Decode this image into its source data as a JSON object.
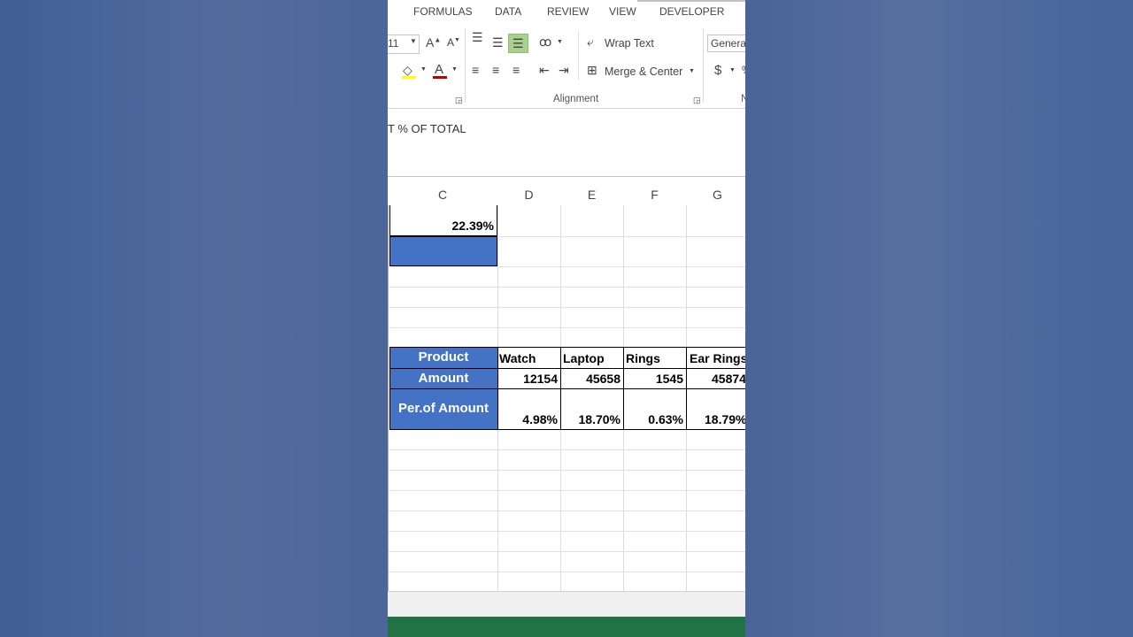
{
  "ribbon": {
    "tabs": [
      "FORMULAS",
      "DATA",
      "REVIEW",
      "VIEW",
      "DEVELOPER"
    ],
    "font_size": "11",
    "wrap_text": "Wrap Text",
    "merge_center": "Merge & Center",
    "number_format": "General",
    "currency": "$",
    "alignment_label": "Alignment",
    "next_group_letter": "N"
  },
  "formula_bar": {
    "content": "T % OF TOTAL"
  },
  "columns": [
    "C",
    "D",
    "E",
    "F",
    "G"
  ],
  "cells": {
    "c1": "22.39%"
  },
  "table": {
    "header_label": "Product",
    "amount_label": "Amount",
    "percent_label": "Per.of Amount",
    "products": [
      "Watch",
      "Laptop",
      "Rings",
      "Ear Rings"
    ],
    "amounts": [
      "12154",
      "45658",
      "1545",
      "45874"
    ],
    "percents": [
      "4.98%",
      "18.70%",
      "0.63%",
      "18.79%"
    ]
  },
  "colors": {
    "accent": "#4472c4",
    "status_bar": "#217346",
    "fill_highlight": "#ffff00",
    "font_color_bar": "#c00000"
  }
}
